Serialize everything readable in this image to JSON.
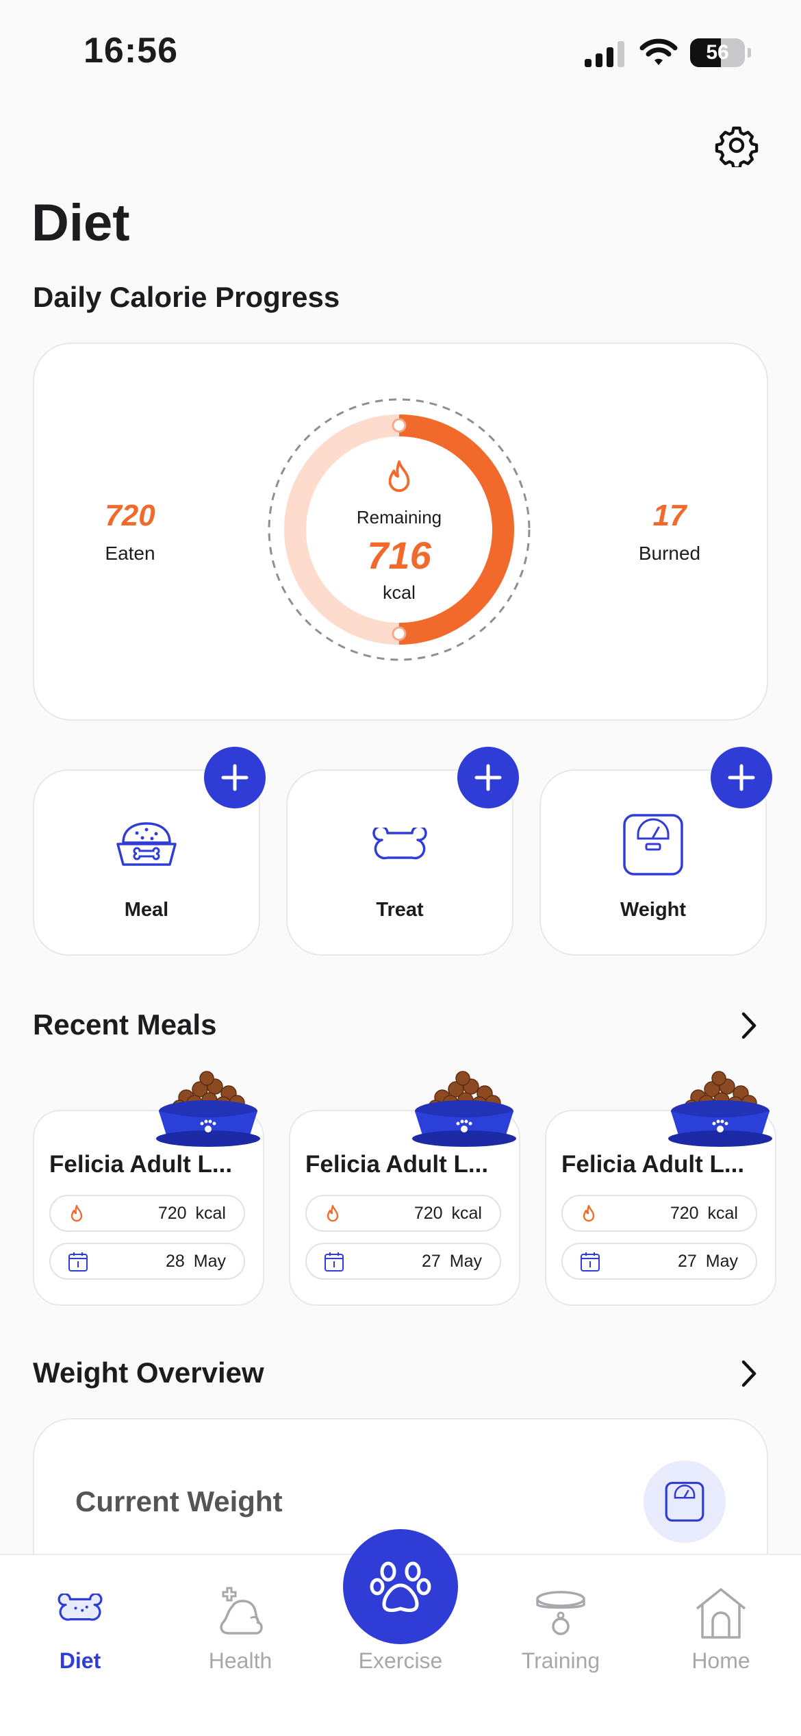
{
  "status_bar": {
    "time": "16:56",
    "battery": "56",
    "battery_level": 0.56
  },
  "page": {
    "title": "Diet"
  },
  "calorie_progress": {
    "section_title": "Daily Calorie Progress",
    "eaten_value": "720",
    "eaten_label": "Eaten",
    "burned_value": "17",
    "burned_label": "Burned",
    "remaining_label": "Remaining",
    "remaining_value": "716",
    "unit": "kcal",
    "progress_fraction": 0.5
  },
  "quick_actions": [
    {
      "label": "Meal"
    },
    {
      "label": "Treat"
    },
    {
      "label": "Weight"
    }
  ],
  "recent_meals": {
    "section_title": "Recent Meals",
    "items": [
      {
        "name": "Felicia Adult L...",
        "calories": "720  kcal",
        "date": "28  May"
      },
      {
        "name": "Felicia Adult L...",
        "calories": "720  kcal",
        "date": "27  May"
      },
      {
        "name": "Felicia Adult L...",
        "calories": "720  kcal",
        "date": "27  May"
      }
    ]
  },
  "weight_overview": {
    "section_title": "Weight Overview",
    "current_weight_label": "Current Weight"
  },
  "bottom_nav": [
    {
      "label": "Diet",
      "active": true
    },
    {
      "label": "Health",
      "active": false
    },
    {
      "label": "Exercise",
      "active": false
    },
    {
      "label": "Training",
      "active": false
    },
    {
      "label": "Home",
      "active": false
    }
  ],
  "colors": {
    "accent_blue": "#2f3dd6",
    "accent_orange": "#f26a2b",
    "ring_light": "#fddccd",
    "inactive_gray": "#a7a7ad"
  }
}
